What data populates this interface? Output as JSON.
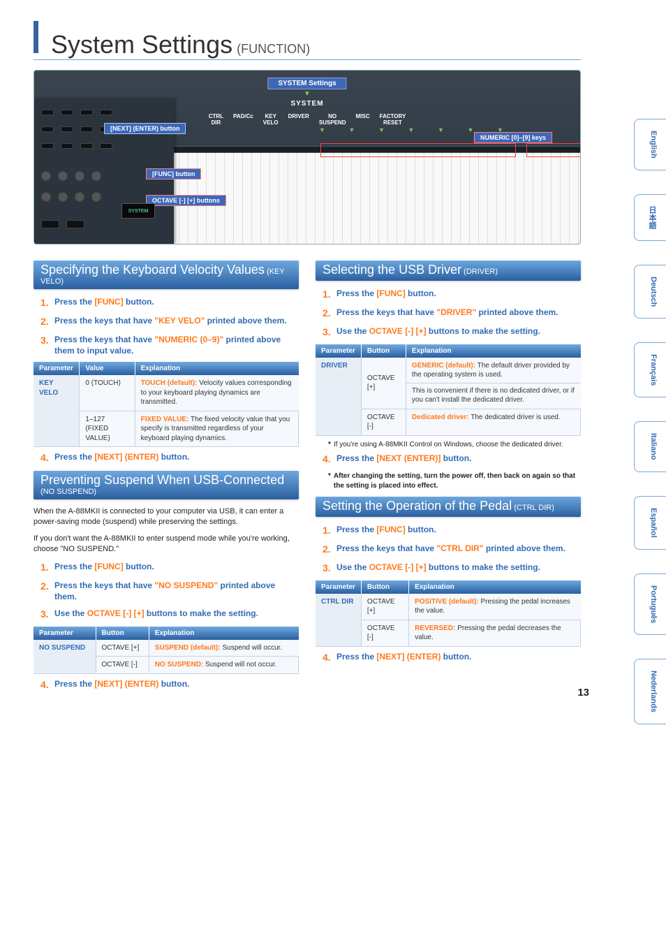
{
  "header": {
    "main": "System Settings",
    "sub": "(FUNCTION)"
  },
  "diagram": {
    "system_settings_label": "SYSTEM Settings",
    "system_text": "SYSTEM",
    "menu_items": [
      "CTRL\nDIR",
      "PAD/Cc",
      "KEY\nVELO",
      "DRIVER",
      "NO\nSUSPEND",
      "MISC",
      "FACTORY\nRESET"
    ],
    "numeric_label": "NUMERIC [0]–[9] keys",
    "callout_next": "[NEXT] (ENTER) button",
    "callout_func": "[FUNC] button",
    "callout_octave": "OCTAVE [-] [+] buttons",
    "screen_text": "SYSTEM"
  },
  "lang_tabs": [
    "English",
    "日本語",
    "Deutsch",
    "Français",
    "Italiano",
    "Español",
    "Português",
    "Nederlands"
  ],
  "page_number": "13",
  "left": {
    "sec1": {
      "title_main": "Specifying the Keyboard Velocity Values",
      "title_sub": "(KEY VELO)",
      "steps": [
        {
          "pre": "Press the ",
          "kw": "[FUNC]",
          "post": " button."
        },
        {
          "pre": "Press the keys that have ",
          "kw": "\"KEY VELO\"",
          "post": " printed above them."
        },
        {
          "pre": "Press the keys that have ",
          "kw": "\"NUMERIC (0–9)\"",
          "post": " printed above them to input value."
        }
      ],
      "table": {
        "headers": [
          "Parameter",
          "Value",
          "Explanation"
        ],
        "param": "KEY VELO",
        "rows": [
          {
            "value": "0 (TOUCH)",
            "exp_bold": "TOUCH (default):",
            "exp": " Velocity values corresponding to your keyboard playing dynamics are transmitted."
          },
          {
            "value": "1–127 (FIXED VALUE)",
            "exp_bold": "FIXED VALUE:",
            "exp": " The fixed velocity value that you specify is transmitted regardless of your keyboard playing dynamics."
          }
        ]
      },
      "step4": {
        "pre": "Press the ",
        "kw": "[NEXT] (ENTER)",
        "post": " button."
      }
    },
    "sec2": {
      "title_main": "Preventing Suspend When USB-Connected",
      "title_sub": "(NO SUSPEND)",
      "body1": "When the A-88MKII is connected to your computer via USB, it can enter a power-saving mode (suspend) while preserving the settings.",
      "body2": "If you don't want the A-88MKII to enter suspend mode while you're working, choose \"NO SUSPEND.\"",
      "steps": [
        {
          "pre": "Press the ",
          "kw": "[FUNC]",
          "post": " button."
        },
        {
          "pre": "Press the keys that have ",
          "kw": "\"NO SUSPEND\"",
          "post": " printed above them."
        },
        {
          "pre": "Use the ",
          "kw": "OCTAVE [-] [+]",
          "post": " buttons to make the setting."
        }
      ],
      "table": {
        "headers": [
          "Parameter",
          "Button",
          "Explanation"
        ],
        "param": "NO SUSPEND",
        "rows": [
          {
            "value": "OCTAVE [+]",
            "exp_bold": "SUSPEND (default):",
            "exp": " Suspend will occur."
          },
          {
            "value": "OCTAVE [-]",
            "exp_bold": "NO SUSPEND:",
            "exp": " Suspend will not occur."
          }
        ]
      },
      "step4": {
        "pre": "Press the ",
        "kw": "[NEXT] (ENTER)",
        "post": " button."
      }
    }
  },
  "right": {
    "sec1": {
      "title_main": "Selecting the USB Driver",
      "title_sub": "(DRIVER)",
      "steps": [
        {
          "pre": "Press the ",
          "kw": "[FUNC]",
          "post": " button."
        },
        {
          "pre": "Press the keys that have ",
          "kw": "\"DRIVER\"",
          "post": " printed above them."
        },
        {
          "pre": "Use the ",
          "kw": "OCTAVE [-] [+]",
          "post": " buttons to make the setting."
        }
      ],
      "table": {
        "headers": [
          "Parameter",
          "Button",
          "Explanation"
        ],
        "param": "DRIVER",
        "rows": [
          {
            "value": "OCTAVE [+]",
            "exp_bold": "GENERIC (default):",
            "exp": " The default driver provided by the operating system is used.",
            "extra": "This is convenient if there is no dedicated driver, or if you can't install the dedicated driver."
          },
          {
            "value": "OCTAVE [-]",
            "exp_bold": "Dedicated driver:",
            "exp": " The dedicated driver is used."
          }
        ]
      },
      "note1": "If you're using A-88MKII Control on Windows, choose the dedicated driver.",
      "step4": {
        "pre": "Press the ",
        "kw": "[NEXT (ENTER)]",
        "post": " button."
      },
      "note2": "After changing the setting, turn the power off, then back on again so that the setting is placed into effect."
    },
    "sec2": {
      "title_main": "Setting the Operation of the Pedal",
      "title_sub": "(CTRL DIR)",
      "steps": [
        {
          "pre": "Press the ",
          "kw": "[FUNC]",
          "post": " button."
        },
        {
          "pre": "Press the keys that have ",
          "kw": "\"CTRL DIR\"",
          "post": " printed above them."
        },
        {
          "pre": "Use the ",
          "kw": "OCTAVE [-] [+]",
          "post": " buttons to make the setting."
        }
      ],
      "table": {
        "headers": [
          "Parameter",
          "Button",
          "Explanation"
        ],
        "param": "CTRL DIR",
        "rows": [
          {
            "value": "OCTAVE [+]",
            "exp_bold": "POSITIVE (default):",
            "exp": " Pressing the pedal increases the value."
          },
          {
            "value": "OCTAVE [-]",
            "exp_bold": "REVERSED:",
            "exp": " Pressing the pedal decreases the value."
          }
        ]
      },
      "step4": {
        "pre": "Press the ",
        "kw": "[NEXT] (ENTER)",
        "post": " button."
      }
    }
  }
}
